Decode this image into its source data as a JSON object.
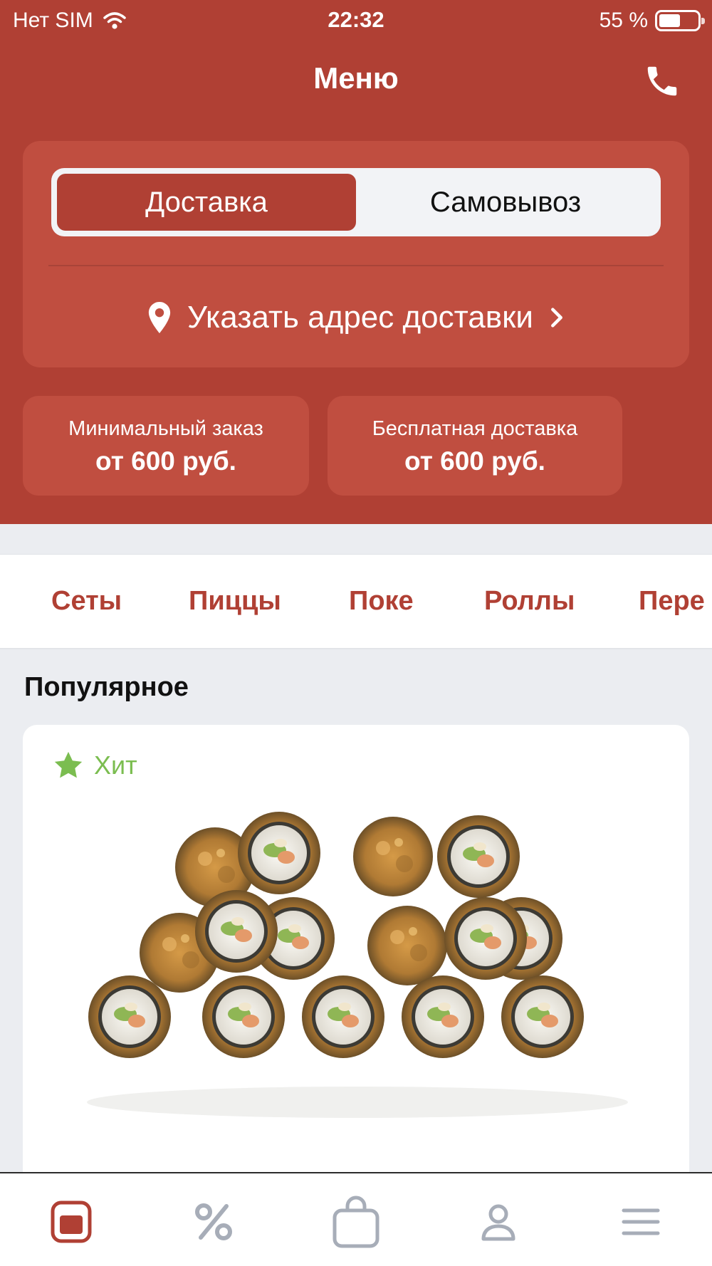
{
  "status_bar": {
    "carrier": "Нет SIM",
    "time": "22:32",
    "battery": "55 %",
    "battery_level": 0.55
  },
  "header": {
    "title": "Меню",
    "call_icon": "phone-icon"
  },
  "delivery_mode": {
    "options": [
      "Доставка",
      "Самовывоз"
    ],
    "selected": "Доставка"
  },
  "address": {
    "label": "Указать адрес доставки",
    "icon": "location-pin-icon"
  },
  "info_cards": [
    {
      "label": "Минимальный заказ",
      "value": "от 600 руб."
    },
    {
      "label": "Бесплатная доставка",
      "value": "от 600 руб."
    }
  ],
  "categories": [
    "Сеты",
    "Пиццы",
    "Поке",
    "Роллы",
    "Пере"
  ],
  "section": {
    "title": "Популярное"
  },
  "product": {
    "badge": "Хит",
    "image": "fried-sushi-rolls-photo"
  },
  "tab_bar": {
    "items": [
      "menu-icon",
      "percent-icon",
      "bag-icon",
      "profile-icon",
      "hamburger-menu-icon"
    ],
    "active": "menu-icon"
  },
  "colors": {
    "brand_red": "#b04034",
    "card_red": "#c04e40",
    "hit_green": "#7bbd50",
    "inactive_icon": "#a7adb8"
  }
}
